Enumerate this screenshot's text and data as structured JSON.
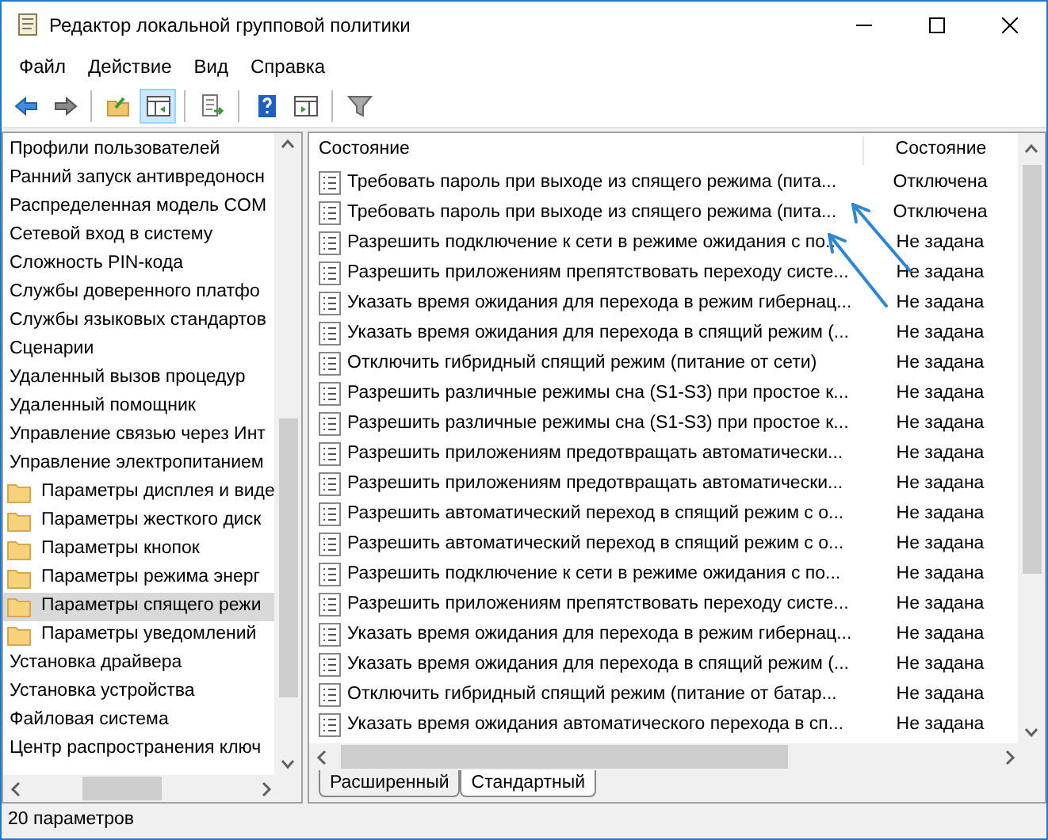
{
  "window": {
    "title": "Редактор локальной групповой политики"
  },
  "menu": [
    "Файл",
    "Действие",
    "Вид",
    "Справка"
  ],
  "toolbar": [
    {
      "kind": "back",
      "pressed": false
    },
    {
      "kind": "forward",
      "pressed": false
    },
    {
      "kind": "sep"
    },
    {
      "kind": "up",
      "pressed": false
    },
    {
      "kind": "tree",
      "pressed": true
    },
    {
      "kind": "sep"
    },
    {
      "kind": "export",
      "pressed": false
    },
    {
      "kind": "sep"
    },
    {
      "kind": "help",
      "pressed": false
    },
    {
      "kind": "pane",
      "pressed": false
    },
    {
      "kind": "sep"
    },
    {
      "kind": "filter",
      "pressed": false
    }
  ],
  "tree": [
    {
      "label": "Профили пользователей",
      "kind": "plain",
      "selected": false
    },
    {
      "label": "Ранний запуск антивредоносн",
      "kind": "plain",
      "selected": false
    },
    {
      "label": "Распределенная модель COM",
      "kind": "plain",
      "selected": false
    },
    {
      "label": "Сетевой вход в систему",
      "kind": "plain",
      "selected": false
    },
    {
      "label": "Сложность PIN-кода",
      "kind": "plain",
      "selected": false
    },
    {
      "label": "Службы доверенного платфо",
      "kind": "plain",
      "selected": false
    },
    {
      "label": "Службы языковых стандартов",
      "kind": "plain",
      "selected": false
    },
    {
      "label": "Сценарии",
      "kind": "plain",
      "selected": false
    },
    {
      "label": "Удаленный вызов процедур",
      "kind": "plain",
      "selected": false
    },
    {
      "label": "Удаленный помощник",
      "kind": "plain",
      "selected": false
    },
    {
      "label": "Управление связью через Инт",
      "kind": "plain",
      "selected": false
    },
    {
      "label": "Управление электропитанием",
      "kind": "plain",
      "selected": false
    },
    {
      "label": "Параметры дисплея и виде",
      "kind": "folder",
      "selected": false
    },
    {
      "label": "Параметры жесткого диск",
      "kind": "folder",
      "selected": false
    },
    {
      "label": "Параметры кнопок",
      "kind": "folder",
      "selected": false
    },
    {
      "label": "Параметры режима энерг",
      "kind": "folder",
      "selected": false
    },
    {
      "label": "Параметры спящего режи",
      "kind": "folder",
      "selected": true
    },
    {
      "label": "Параметры уведомлений",
      "kind": "folder",
      "selected": false
    },
    {
      "label": "Установка драйвера",
      "kind": "plain",
      "selected": false
    },
    {
      "label": "Установка устройства",
      "kind": "plain",
      "selected": false
    },
    {
      "label": "Файловая система",
      "kind": "plain",
      "selected": false
    },
    {
      "label": "Центр распространения ключ",
      "kind": "plain",
      "selected": false
    }
  ],
  "table": {
    "columns": [
      "Состояние",
      "Состояние"
    ],
    "rows": [
      {
        "name": "Требовать пароль при выходе из спящего режима (пита...",
        "state": "Отключена"
      },
      {
        "name": "Требовать пароль при выходе из спящего режима (пита...",
        "state": "Отключена"
      },
      {
        "name": "Разрешить подключение к сети в режиме ожидания с по...",
        "state": "Не задана"
      },
      {
        "name": "Разрешить приложениям препятствовать переходу систе...",
        "state": "Не задана"
      },
      {
        "name": "Указать время ожидания для перехода в режим гибернац...",
        "state": "Не задана"
      },
      {
        "name": "Указать время ожидания для перехода в спящий режим (...",
        "state": "Не задана"
      },
      {
        "name": "Отключить гибридный спящий режим (питание от сети)",
        "state": "Не задана"
      },
      {
        "name": "Разрешить различные режимы сна (S1-S3) при простое к...",
        "state": "Не задана"
      },
      {
        "name": "Разрешить различные режимы сна (S1-S3) при простое к...",
        "state": "Не задана"
      },
      {
        "name": "Разрешить приложениям предотвращать автоматически...",
        "state": "Не задана"
      },
      {
        "name": "Разрешить приложениям предотвращать автоматически...",
        "state": "Не задана"
      },
      {
        "name": "Разрешить автоматический переход в спящий режим с о...",
        "state": "Не задана"
      },
      {
        "name": "Разрешить автоматический переход в спящий режим с о...",
        "state": "Не задана"
      },
      {
        "name": "Разрешить подключение к сети в режиме ожидания с по...",
        "state": "Не задана"
      },
      {
        "name": "Разрешить приложениям препятствовать переходу систе...",
        "state": "Не задана"
      },
      {
        "name": "Указать время ожидания для перехода в режим гибернац...",
        "state": "Не задана"
      },
      {
        "name": "Указать время ожидания для перехода в спящий режим (...",
        "state": "Не задана"
      },
      {
        "name": "Отключить гибридный спящий режим (питание от батар...",
        "state": "Не задана"
      },
      {
        "name": "Указать время ожидания автоматического перехода в сп...",
        "state": "Не задана"
      }
    ]
  },
  "tabs": [
    {
      "label": "Расширенный",
      "selected": false
    },
    {
      "label": "Стандартный",
      "selected": true
    }
  ],
  "status_bar": "20 параметров"
}
